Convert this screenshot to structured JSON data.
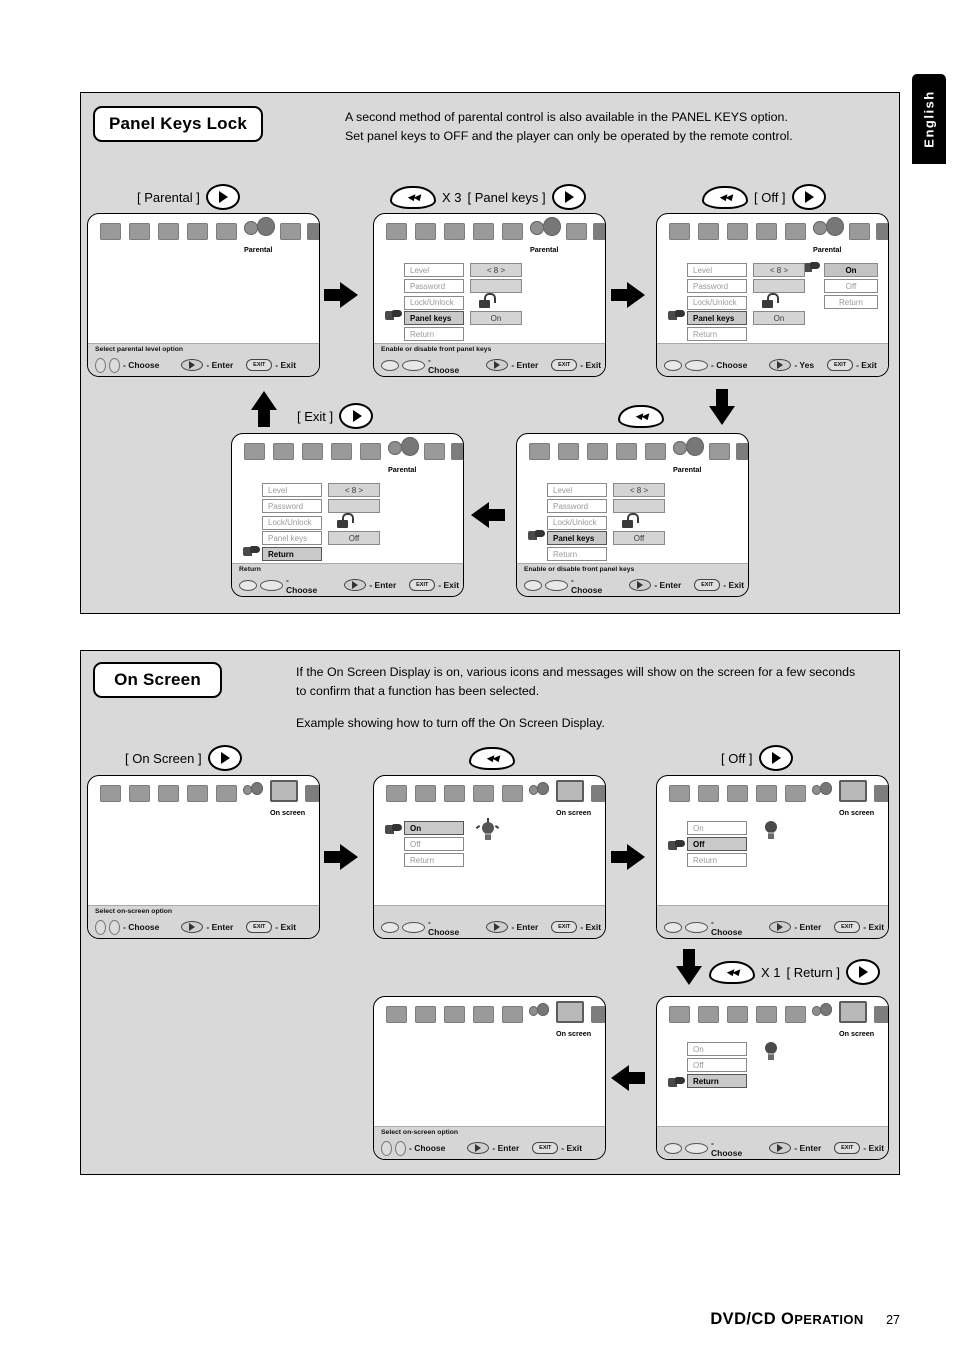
{
  "page": {
    "language_tab": "English",
    "footer_title_main": "DVD/CD",
    "footer_title_caps": "O",
    "footer_title_rest": "PERATION",
    "footer_page": "27"
  },
  "sections": [
    {
      "id": "panel-keys-lock",
      "title": "Panel Keys Lock",
      "desc_line1": "A second method of parental control is also available in the PANEL KEYS option.",
      "desc_line2": "Set panel keys to OFF and the player can only be operated by the remote control.",
      "steps": [
        {
          "label": "[ Parental ]",
          "key": "play-icon"
        },
        {
          "prefix_key": "prev-icon",
          "count": "X 3",
          "label": "[ Panel keys ]",
          "key": "play-icon"
        },
        {
          "prefix_key": "prev-icon",
          "label": "[ Off ]",
          "key": "play-icon"
        },
        {
          "label": "[ Exit ]",
          "key": "play-icon"
        }
      ]
    },
    {
      "id": "on-screen",
      "title": "On Screen",
      "desc_line1": "If the On Screen Display is on, various icons and messages will show on the screen for a few seconds",
      "desc_line2": "to confirm that a function has been selected.",
      "desc_line3": "Example showing how to turn off the On Screen Display.",
      "steps": [
        {
          "label": "[ On Screen ]",
          "key": "play-icon"
        },
        {
          "prefix_key": "prev-icon"
        },
        {
          "label": "[ Off ]",
          "key": "play-icon"
        },
        {
          "prefix_key": "prev-icon",
          "count": "X 1",
          "label": "[ Return ]",
          "key": "play-icon"
        }
      ]
    }
  ],
  "screens": {
    "parental_root": {
      "icon_label": "Parental",
      "hint": "Select parental level option",
      "keys": {
        "choose": "- Choose",
        "enter": "- Enter",
        "exit": "- Exit",
        "exit_key": "EXIT"
      }
    },
    "parental_menu_on": {
      "icon_label": "Parental",
      "rows": [
        {
          "label": "Level",
          "value": "< 8 >"
        },
        {
          "label": "Password",
          "value": ""
        },
        {
          "label": "Lock/Unlock",
          "value": "lock-icon"
        },
        {
          "label": "Panel keys",
          "value": "On"
        },
        {
          "label": "Return",
          "value": ""
        }
      ],
      "selected": "Panel keys",
      "hint": "Enable or disable front panel keys",
      "keys": {
        "choose": "- Choose",
        "enter": "- Enter",
        "exit": "- Exit",
        "exit_key": "EXIT"
      }
    },
    "parental_submenu": {
      "icon_label": "Parental",
      "rows": [
        {
          "label": "Level",
          "value": "< 8 >"
        },
        {
          "label": "Password",
          "value": ""
        },
        {
          "label": "Lock/Unlock",
          "value": "lock-icon"
        },
        {
          "label": "Panel keys",
          "value": "On"
        },
        {
          "label": "Return",
          "value": ""
        }
      ],
      "selected": "Panel keys",
      "submenu": [
        "On",
        "Off",
        "Return"
      ],
      "submenu_selected": "On",
      "hint": "",
      "keys": {
        "choose": "- Choose",
        "enter": "- Yes",
        "exit": "- Exit",
        "exit_key": "EXIT"
      }
    },
    "parental_menu_off": {
      "icon_label": "Parental",
      "rows": [
        {
          "label": "Level",
          "value": "< 8 >"
        },
        {
          "label": "Password",
          "value": ""
        },
        {
          "label": "Lock/Unlock",
          "value": "lock-icon"
        },
        {
          "label": "Panel keys",
          "value": "Off"
        },
        {
          "label": "Return",
          "value": ""
        }
      ],
      "selected": "Panel keys",
      "hint": "Enable or disable front panel keys",
      "keys": {
        "choose": "- Choose",
        "enter": "- Enter",
        "exit": "- Exit",
        "exit_key": "EXIT"
      }
    },
    "parental_menu_return": {
      "icon_label": "Parental",
      "rows": [
        {
          "label": "Level",
          "value": "< 8 >"
        },
        {
          "label": "Password",
          "value": ""
        },
        {
          "label": "Lock/Unlock",
          "value": "lock-icon"
        },
        {
          "label": "Panel keys",
          "value": "Off"
        },
        {
          "label": "Return",
          "value": ""
        }
      ],
      "selected": "Return",
      "hint": "Return",
      "keys": {
        "choose": "- Choose",
        "enter": "- Enter",
        "exit": "- Exit",
        "exit_key": "EXIT"
      }
    },
    "onscreen_root": {
      "icon_label": "On screen",
      "hint": "Select on-screen option",
      "keys": {
        "choose": "- Choose",
        "enter": "- Enter",
        "exit": "- Exit",
        "exit_key": "EXIT"
      }
    },
    "onscreen_on": {
      "icon_label": "On screen",
      "rows": [
        "On",
        "Off",
        "Return"
      ],
      "selected": "On",
      "bulb": "bulb-on",
      "hint": "",
      "keys": {
        "choose": "- Choose",
        "enter": "- Enter",
        "exit": "- Exit",
        "exit_key": "EXIT"
      }
    },
    "onscreen_off": {
      "icon_label": "On screen",
      "rows": [
        "On",
        "Off",
        "Return"
      ],
      "selected": "Off",
      "bulb": "bulb-off",
      "hint": "",
      "keys": {
        "choose": "- Choose",
        "enter": "- Enter",
        "exit": "- Exit",
        "exit_key": "EXIT"
      }
    },
    "onscreen_return": {
      "icon_label": "On screen",
      "rows": [
        "On",
        "Off",
        "Return"
      ],
      "selected": "Return",
      "bulb": "bulb-off",
      "hint": "",
      "keys": {
        "choose": "- Choose",
        "enter": "- Enter",
        "exit": "- Exit",
        "exit_key": "EXIT"
      }
    },
    "onscreen_root2": {
      "icon_label": "On screen",
      "hint": "Select on-screen option",
      "keys": {
        "choose": "- Choose",
        "enter": "- Enter",
        "exit": "- Exit",
        "exit_key": "EXIT"
      }
    }
  }
}
